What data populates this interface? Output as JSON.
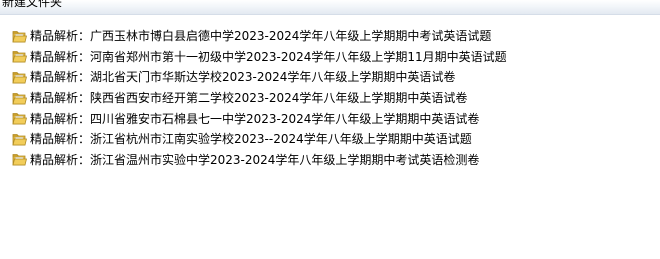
{
  "window": {
    "title": "新建文件夹"
  },
  "files": [
    {
      "name": "精品解析：广西玉林市博白县启德中学2023-2024学年八年级上学期期中考试英语试题",
      "icon": "folder-icon"
    },
    {
      "name": "精品解析：河南省郑州市第十一初级中学2023-2024学年八年级上学期11月期中英语试题",
      "icon": "folder-icon"
    },
    {
      "name": "精品解析：湖北省天门市华斯达学校2023-2024学年八年级上学期期中英语试卷",
      "icon": "folder-icon"
    },
    {
      "name": "精品解析：陕西省西安市经开第二学校2023-2024学年八年级上学期期中英语试卷",
      "icon": "folder-icon"
    },
    {
      "name": "精品解析：四川省雅安市石棉县七一中学2023-2024学年八年级上学期期中英语试卷",
      "icon": "folder-icon"
    },
    {
      "name": "精品解析：浙江省杭州市江南实验学校2023--2024学年八年级上学期期中英语试题",
      "icon": "folder-icon"
    },
    {
      "name": "精品解析：浙江省温州市实验中学2023-2024学年八年级上学期期中考试英语检测卷",
      "icon": "folder-icon"
    }
  ]
}
